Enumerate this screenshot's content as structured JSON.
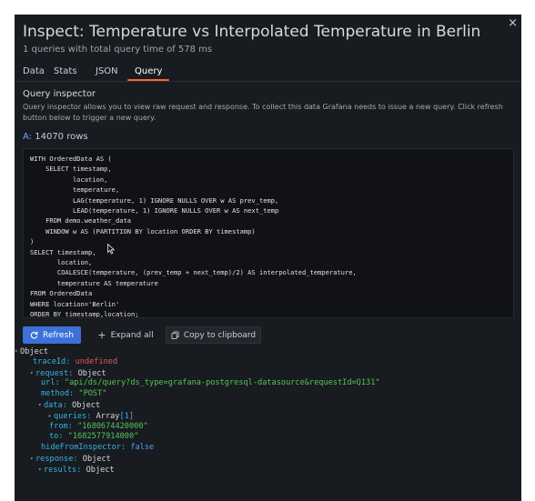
{
  "modal": {
    "title": "Inspect: Temperature vs Interpolated Temperature in Berlin",
    "subtitle": "1 queries with total query time of 578 ms",
    "close": "×"
  },
  "tabs": [
    {
      "label": "Data",
      "active": false
    },
    {
      "label": "Stats",
      "active": false
    },
    {
      "label": "JSON",
      "active": false
    },
    {
      "label": "Query",
      "active": true
    }
  ],
  "query_inspector": {
    "title": "Query inspector",
    "description": "Query inspector allows you to view raw request and response. To collect this data Grafana needs to issue a new query. Click refresh button below to trigger a new query.",
    "query_letter": "A:",
    "rows": "14070 rows",
    "sql": "WITH OrderedData AS (\n    SELECT timestamp,\n           location,\n           temperature,\n           LAG(temperature, 1) IGNORE NULLS OVER w AS prev_temp,\n           LEAD(temperature, 1) IGNORE NULLS OVER w AS next_temp\n    FROM demo.weather_data\n    WINDOW w AS (PARTITION BY location ORDER BY timestamp)\n)\nSELECT timestamp,\n       location,\n       COALESCE(temperature, (prev_temp + next_temp)/2) AS interpolated_temperature,\n       temperature AS temperature\nFROM OrderedData\nWHERE location='Berlin'\nORDER BY timestamp,location;"
  },
  "buttons": {
    "refresh": "Refresh",
    "expand_all": "Expand all",
    "copy": "Copy to clipboard"
  },
  "tree": {
    "root": "Object",
    "traceId_key": "traceId:",
    "traceId_val": "undefined",
    "request_key": "request:",
    "request_type": "Object",
    "url_key": "url:",
    "url_val": "\"api/ds/query?ds_type=grafana-postgresql-datasource&requestId=Q131\"",
    "method_key": "method:",
    "method_val": "\"POST\"",
    "data_key": "data:",
    "data_type": "Object",
    "queries_key": "queries:",
    "queries_type": "Array",
    "queries_count": "[1]",
    "from_key": "from:",
    "from_val": "\"1680674420000\"",
    "to_key": "to:",
    "to_val": "\"1682577914000\"",
    "hide_key": "hideFromInspector:",
    "hide_val": "false",
    "response_key": "response:",
    "response_type": "Object",
    "results_key": "results:",
    "results_type": "Object"
  },
  "colors": {
    "panel_bg": "#181b1f",
    "accent_tab": "#f5663a",
    "primary_button": "#3d71d9",
    "string_value": "#55c45c",
    "key_value": "#33b5e5",
    "undefined_value": "#e0575f"
  }
}
